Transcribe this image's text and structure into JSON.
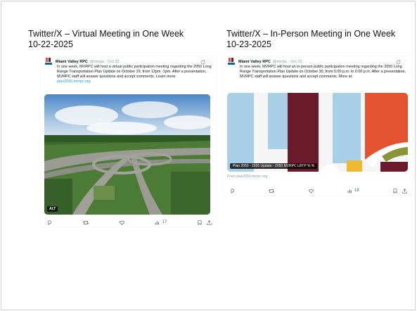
{
  "slide": {
    "left_heading": {
      "line1": "Twitter/X – Virtual Meeting in One Week",
      "line2": "10-22-2025"
    },
    "right_heading": {
      "line1": "Twitter/X – In-Person Meeting in One Week",
      "line2": "10-23-2025"
    }
  },
  "posts": [
    {
      "author": "Miami Valley RPC",
      "handle": "@mvrpc · Oct 22",
      "text": "In one week, MVRPC will host a virtual public participation meeting regarding the 2050 Long Range Transportation Plan Update on October 29, from 12pm -1pm. After a presentation, MVRPC staff will answer questions and accept comments. Learn more: ",
      "link": "plan2050.mvrpc.org.",
      "media_badge": "ALT",
      "views": "17"
    },
    {
      "author": "Miami Valley RPC",
      "handle": "@mvrpc · Oct 23",
      "text": "In one week, MVRPC will host an in-person public participation meeting regarding the 2050 Long Range Transportation Plan Update on October 30, from 5:00 p.m. to 6:00 p.m. After a presentation, MVRPC staff will answer questions and accept comments. More at:",
      "card_caption": "Plan 2050 - 2026 Update - 2050 MVRPC LRTP % %",
      "card_source": "From plan2050.mvrpc.org",
      "views": "18"
    }
  ],
  "colors": {
    "link": "#1d9bf0",
    "muted": "#536471",
    "graphic_blue": "#a8cfe6",
    "graphic_maroon": "#6b1a2c",
    "graphic_orange": "#e4532f",
    "graphic_olive": "#8c9438",
    "graphic_yellow": "#f0b731"
  },
  "icons": [
    "reply-icon",
    "repost-icon",
    "like-icon",
    "views-icon",
    "bookmark-icon",
    "share-icon",
    "grok-icon",
    "more-icon"
  ]
}
